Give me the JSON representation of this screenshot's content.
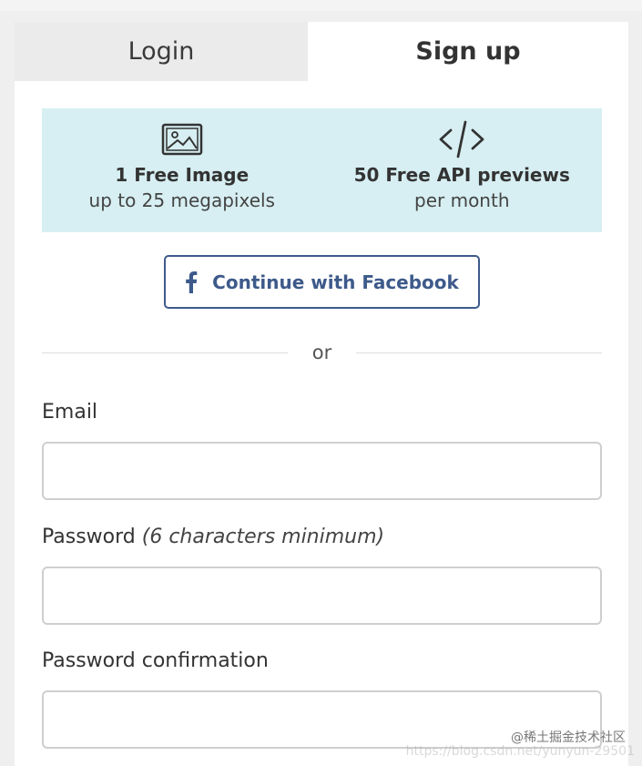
{
  "tabs": {
    "login": "Login",
    "signup": "Sign up"
  },
  "promo": {
    "image": {
      "icon": "image-icon",
      "title": "1 Free Image",
      "subtitle": "up to 25 megapixels"
    },
    "api": {
      "icon": "code-icon",
      "title": "50 Free API previews",
      "subtitle": "per month"
    }
  },
  "facebook": {
    "icon": "facebook-icon",
    "label": "Continue with Facebook",
    "color": "#3d5a8a"
  },
  "divider": {
    "text": "or"
  },
  "form": {
    "email": {
      "label": "Email",
      "value": "",
      "placeholder": ""
    },
    "password": {
      "label": "Password",
      "hint": "(6 characters minimum)",
      "value": "",
      "placeholder": ""
    },
    "password_confirmation": {
      "label": "Password confirmation",
      "value": "",
      "placeholder": ""
    }
  },
  "colors": {
    "promo_bg": "#d7eff2",
    "accent": "#3d5a8a"
  },
  "watermark": {
    "line1": "@稀土掘金技术社区",
    "line2": "https://blog.csdn.net/yunyun-29501"
  }
}
